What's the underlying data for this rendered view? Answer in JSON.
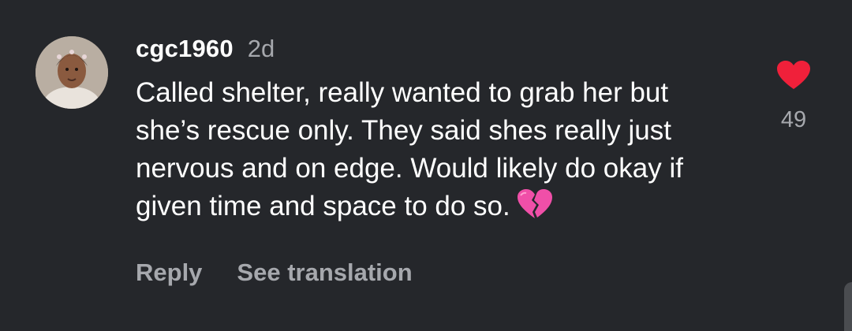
{
  "comment": {
    "username": "cgc1960",
    "timestamp": "2d",
    "text": "Called shelter, really wanted to grab her but she’s rescue only. They said shes really just nervous and on edge. Would likely do okay if given time and space to do so.",
    "emoji": "broken-heart-icon",
    "reply_label": "Reply",
    "translation_label": "See translation",
    "like_count": "49",
    "like_icon": "heart-icon",
    "like_color": "#f0203a"
  },
  "colors": {
    "background": "#25272b",
    "primary_text": "#ffffff",
    "secondary_text": "#a6a8ad",
    "emoji_pink": "#f04fa8"
  }
}
